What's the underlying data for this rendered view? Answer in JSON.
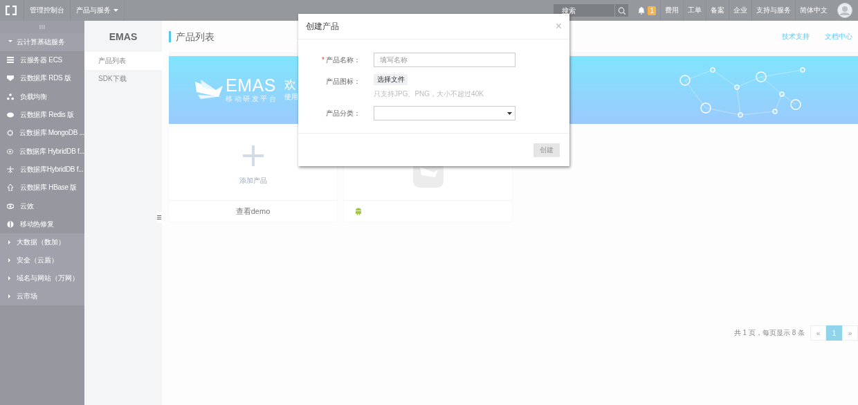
{
  "topbar": {
    "console": "管理控制台",
    "products_menu": "产品与服务",
    "search": {
      "placeholder": "搜索"
    },
    "notifications": {
      "badge": "1"
    },
    "links": [
      "费用",
      "工单",
      "备案",
      "企业",
      "支持与服务",
      "简体中文"
    ]
  },
  "sidebar": {
    "sections": [
      {
        "label": "云计算基础服务",
        "expanded": true,
        "items": [
          "云服务器 ECS",
          "云数据库 RDS 版",
          "负载均衡",
          "云数据库 Redis 版",
          "云数据库 MongoDB ...",
          "云数据库 HybridDB f...",
          "云数据库HybridDB f...",
          "云数据库 HBase 版",
          "云效",
          "移动热修复"
        ]
      },
      {
        "label": "大数据（数加）",
        "expanded": false
      },
      {
        "label": "安全（云盾）",
        "expanded": false
      },
      {
        "label": "域名与网站（万网）",
        "expanded": false
      },
      {
        "label": "云市场",
        "expanded": false
      }
    ]
  },
  "subnav": {
    "title": "EMAS",
    "items": [
      {
        "label": "产品列表",
        "selected": true
      },
      {
        "label": "SDK下载",
        "selected": false
      }
    ]
  },
  "page": {
    "title": "产品列表",
    "links": [
      "技术支持",
      "文档中心"
    ],
    "banner": {
      "logo_text": "EMAS",
      "logo_subtitle": "移动研发平台",
      "welcome": "欢",
      "welcome_sub": "使用"
    },
    "add_card": {
      "label": "添加产品",
      "footer": "查看demo"
    },
    "pagination": {
      "summary": "共 1 页，每页显示 8 条",
      "prev": "«",
      "pages": [
        {
          "label": "1",
          "selected": true
        }
      ],
      "next": "»"
    }
  },
  "dialog": {
    "title": "创建产品",
    "close": "×",
    "fields": [
      {
        "kind": "text",
        "required_mark": "*",
        "label": "产品名称：",
        "placeholder": "填写名称"
      },
      {
        "kind": "file",
        "label": "产品图标：",
        "button": "选择文件",
        "hint": "只支持JPG、PNG，大小不超过40K"
      },
      {
        "kind": "select",
        "label": "产品分类："
      }
    ],
    "submit": {
      "label": "创建",
      "disabled": true
    }
  }
}
